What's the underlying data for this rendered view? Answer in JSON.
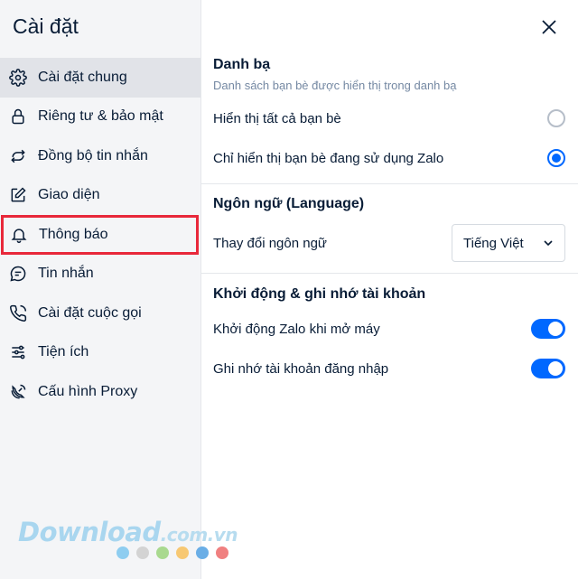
{
  "sidebar": {
    "title": "Cài đặt",
    "items": [
      {
        "label": "Cài đặt chung",
        "icon": "gear-icon"
      },
      {
        "label": "Riêng tư & bảo mật",
        "icon": "lock-icon"
      },
      {
        "label": "Đồng bộ tin nhắn",
        "icon": "sync-icon"
      },
      {
        "label": "Giao diện",
        "icon": "edit-icon"
      },
      {
        "label": "Thông báo",
        "icon": "bell-icon"
      },
      {
        "label": "Tin nhắn",
        "icon": "chat-icon"
      },
      {
        "label": "Cài đặt cuộc gọi",
        "icon": "phone-icon"
      },
      {
        "label": "Tiện ích",
        "icon": "sliders-icon"
      },
      {
        "label": "Cấu hình Proxy",
        "icon": "satellite-icon"
      }
    ]
  },
  "contacts": {
    "title": "Danh bạ",
    "desc": "Danh sách bạn bè được hiển thị trong danh bạ",
    "option_all": "Hiển thị tất cả bạn bè",
    "option_zalo": "Chỉ hiển thị bạn bè đang sử dụng Zalo",
    "selected": "option_zalo"
  },
  "language": {
    "title": "Ngôn ngữ (Language)",
    "change_label": "Thay đổi ngôn ngữ",
    "value": "Tiếng Việt"
  },
  "startup": {
    "title": "Khởi động & ghi nhớ tài khoản",
    "start_label": "Khởi động Zalo khi mở máy",
    "remember_label": "Ghi nhớ tài khoản đăng nhập",
    "start_on": true,
    "remember_on": true
  },
  "watermark": {
    "text": "Download",
    "tld": ".com.vn",
    "dot_colors": [
      "#8ecdf0",
      "#d3d3d3",
      "#a9d98f",
      "#f7c873",
      "#6aaee6",
      "#f08080"
    ]
  },
  "colors": {
    "accent": "#0068ff",
    "highlight": "#e8283a"
  }
}
